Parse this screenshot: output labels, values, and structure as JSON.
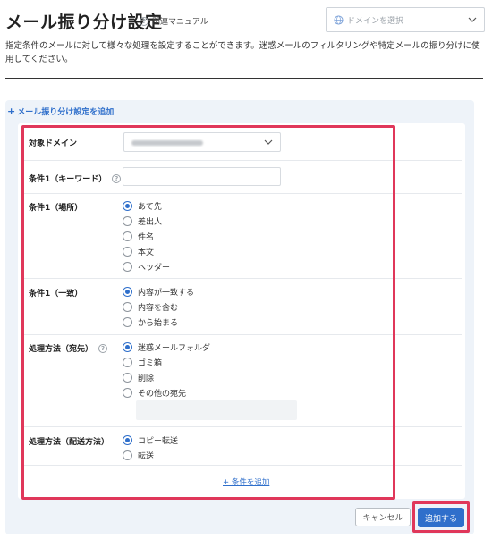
{
  "header": {
    "title": "メール振り分け設定",
    "manual_link": "関連マニュアル",
    "help_glyph": "?"
  },
  "domain_select": {
    "placeholder": "ドメインを選択"
  },
  "description": "指定条件のメールに対して様々な処理を設定することができます。迷惑メールのフィルタリングや特定メールの振り分けに使用してください。",
  "add_setting_link": "メール振り分け設定を追加",
  "form": {
    "target_domain": {
      "label": "対象ドメイン"
    },
    "keyword": {
      "label": "条件1（キーワード）",
      "value": ""
    },
    "location": {
      "label": "条件1（場所）",
      "options": [
        "あて先",
        "差出人",
        "件名",
        "本文",
        "ヘッダー"
      ],
      "selected": "あて先"
    },
    "match": {
      "label": "条件1（一致）",
      "options": [
        "内容が一致する",
        "内容を含む",
        "から始まる"
      ],
      "selected": "内容が一致する"
    },
    "destination": {
      "label": "処理方法（宛先）",
      "options": [
        "迷惑メールフォルダ",
        "ゴミ箱",
        "削除",
        "その他の宛先"
      ],
      "selected": "迷惑メールフォルダ"
    },
    "delivery": {
      "label": "処理方法（配送方法）",
      "options": [
        "コピー転送",
        "転送"
      ],
      "selected": "コピー転送"
    },
    "add_condition": "+ 条件を追加"
  },
  "buttons": {
    "cancel": "キャンセル",
    "submit": "追加する"
  },
  "colors": {
    "accent": "#2f6fcb",
    "highlight": "#e0375a",
    "panel_bg": "#eef3f9"
  }
}
